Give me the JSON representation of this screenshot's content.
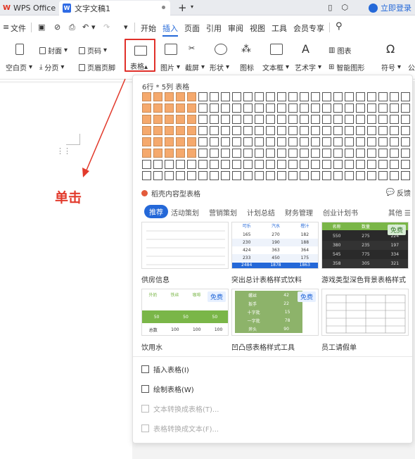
{
  "titlebar": {
    "app_tab": "WPS Office",
    "doc_tab": "文字文稿1",
    "login": "立即登录"
  },
  "menu": {
    "file": "文件",
    "items": [
      "开始",
      "插入",
      "页面",
      "引用",
      "审阅",
      "视图",
      "工具",
      "会员专享"
    ],
    "active": "插入"
  },
  "ribbon": {
    "blank_page": "空白页",
    "cover": "封面",
    "page_break": "分页",
    "page_number": "页码",
    "header_footer": "页眉页脚",
    "table": "表格",
    "picture": "图片",
    "screenshot": "截屏",
    "shape": "形状",
    "icon": "图标",
    "textbox": "文本框",
    "wordart": "艺术字",
    "chart": "图表",
    "smartart": "智能图形",
    "symbol": "符号",
    "formula": "公"
  },
  "annotation": {
    "label": "单击",
    "color": "#e23a2c"
  },
  "dropdown": {
    "grid_title": "6行 * 5列 表格",
    "grid_cols": 24,
    "grid_rows": 8,
    "selected_rows": 6,
    "selected_cols": 5,
    "ai_title": "稻壳内容型表格",
    "feedback": "反馈",
    "categories": [
      "推荐",
      "活动策划",
      "营销策划",
      "计划总结",
      "财务管理",
      "创业计划书"
    ],
    "more": "其他",
    "templates": [
      {
        "name": "供房信息",
        "free": ""
      },
      {
        "name": "突出总计表格样式饮料",
        "free": ""
      },
      {
        "name": "游戏类型深色背景表格样式",
        "free": "免费"
      },
      {
        "name": "饮用水",
        "free": "免费"
      },
      {
        "name": "凹凸感表格样式工具",
        "free": "免费"
      },
      {
        "name": "员工请假单",
        "free": ""
      }
    ],
    "t2_headers": [
      "可乐",
      "汽水",
      "橙汁"
    ],
    "t2_rows": [
      [
        "165",
        "270",
        "182"
      ],
      [
        "230",
        "190",
        "188"
      ],
      [
        "424",
        "363",
        "364"
      ],
      [
        "233",
        "450",
        "175"
      ]
    ],
    "t2_total": [
      "2484",
      "1878",
      "1863"
    ],
    "t3_headers": [
      "名称",
      "数量",
      "价格"
    ],
    "t3_rows": [
      [
        "550",
        "275",
        "224"
      ],
      [
        "380",
        "235",
        "197"
      ],
      [
        "545",
        "775",
        "334"
      ],
      [
        "358",
        "305",
        "321"
      ]
    ],
    "t4_labels": [
      "外奶",
      "铁丝",
      "咖啡",
      "果汁"
    ],
    "t4_total_label": "总数",
    "t4_rows": [
      [
        "50",
        "50",
        "50"
      ],
      [
        "100",
        "100",
        "100"
      ]
    ],
    "t5_rows": [
      [
        "螺丝",
        "42"
      ],
      [
        "扳手",
        "22"
      ],
      [
        "十字批",
        "15"
      ],
      [
        "一字批",
        "78"
      ],
      [
        "斧头",
        "90"
      ]
    ],
    "actions": [
      {
        "label": "插入表格(I)",
        "enabled": true
      },
      {
        "label": "绘制表格(W)",
        "enabled": true
      },
      {
        "label": "文本转换成表格(T)...",
        "enabled": false
      },
      {
        "label": "表格转换成文本(F)...",
        "enabled": false
      }
    ]
  }
}
